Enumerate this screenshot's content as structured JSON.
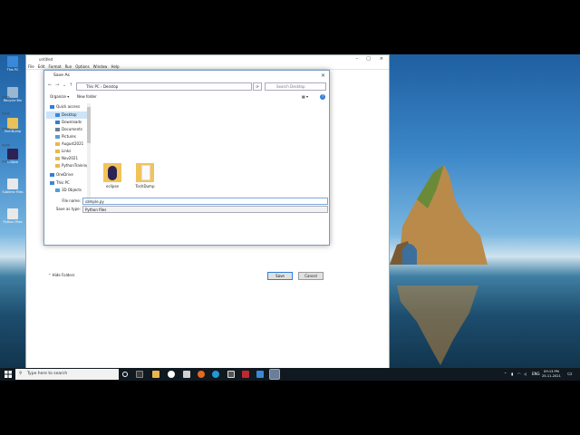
{
  "desktop": {
    "icons": [
      {
        "label": "This PC"
      },
      {
        "label": "Recycle Bin"
      },
      {
        "label": "TechDump"
      },
      {
        "label": "eclipse"
      },
      {
        "label": "Sublime Files"
      },
      {
        "label": "Python Files"
      }
    ]
  },
  "editor": {
    "title": "untitled",
    "menu": [
      "File",
      "Edit",
      "Format",
      "Run",
      "Options",
      "Window",
      "Help"
    ],
    "prompt": ">>>"
  },
  "dialog": {
    "title": "Save As",
    "close": "×",
    "breadcrumb": [
      "This PC",
      "Desktop"
    ],
    "search_placeholder": "Search Desktop",
    "toolbar": {
      "organize": "Organize ▾",
      "new_folder": "New folder",
      "help": "?"
    },
    "nav_items": [
      {
        "label": "Quick access",
        "icon": "star-icon",
        "color": "#2f7fd6"
      },
      {
        "label": "Desktop",
        "icon": "desktop-icon",
        "color": "#3a88d8",
        "selected": true
      },
      {
        "label": "Downloads",
        "icon": "download-icon",
        "color": "#2f7fd6"
      },
      {
        "label": "Documents",
        "icon": "document-icon",
        "color": "#6a7e98"
      },
      {
        "label": "Pictures",
        "icon": "pictures-icon",
        "color": "#5a9bd5"
      },
      {
        "label": "August2021",
        "icon": "folder-icon",
        "color": "#e8b84a"
      },
      {
        "label": "Links",
        "icon": "folder-icon",
        "color": "#e8b84a"
      },
      {
        "label": "Nov2021",
        "icon": "folder-icon",
        "color": "#e8b84a"
      },
      {
        "label": "PythonTraining",
        "icon": "folder-icon",
        "color": "#e8b84a"
      },
      {
        "label": "OneDrive",
        "icon": "cloud-icon",
        "color": "#2f7fd6"
      },
      {
        "label": "This PC",
        "icon": "pc-icon",
        "color": "#3a88d8"
      },
      {
        "label": "3D Objects",
        "icon": "cube-icon",
        "color": "#4aa3df"
      }
    ],
    "files": [
      {
        "label": "eclipse"
      },
      {
        "label": "TechDump"
      }
    ],
    "file_name_label": "File name:",
    "file_name_value": "sample.py",
    "save_type_label": "Save as type:",
    "save_type_value": "Python files",
    "hide_folders": "Hide Folders",
    "save_button": "Save",
    "cancel_button": "Cancel"
  },
  "taskbar": {
    "search_placeholder": "Type here to search",
    "language": "ENG",
    "time": "09:13 PM",
    "date": "25-11-2021"
  },
  "colors": {
    "accent": "#0078d7",
    "taskbar": "#101820"
  }
}
